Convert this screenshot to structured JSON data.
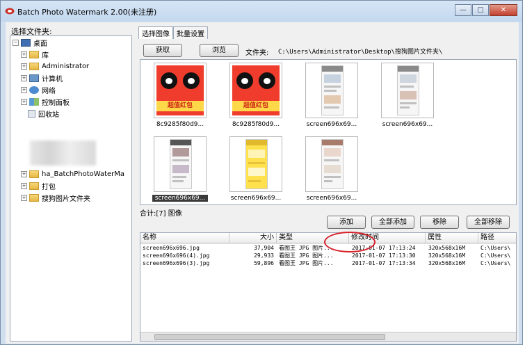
{
  "window": {
    "title": "Batch Photo Watermark 2.00(未注册)",
    "minimize_glyph": "—",
    "maximize_glyph": "□",
    "close_glyph": "✕"
  },
  "left_panel": {
    "label": "选择文件夹:",
    "tree": [
      {
        "label": "桌面",
        "icon": "desktop-icon",
        "expander": "−"
      },
      {
        "label": "库",
        "icon": "library-icon",
        "expander": "+"
      },
      {
        "label": "Administrator",
        "icon": "user-folder-icon",
        "expander": "+"
      },
      {
        "label": "计算机",
        "icon": "computer-icon",
        "expander": "+"
      },
      {
        "label": "网络",
        "icon": "network-icon",
        "expander": "+"
      },
      {
        "label": "控制面板",
        "icon": "control-panel-icon",
        "expander": "+"
      },
      {
        "label": "回收站",
        "icon": "recycle-bin-icon",
        "expander": ""
      },
      {
        "label": "ha_BatchPhotoWaterMa",
        "icon": "folder-icon",
        "expander": "+"
      },
      {
        "label": "打包",
        "icon": "folder-icon",
        "expander": "+"
      },
      {
        "label": "搜狗图片文件夹",
        "icon": "folder-icon",
        "expander": "+"
      }
    ]
  },
  "tabs": [
    "选择图像",
    "批量设置"
  ],
  "toolbar": {
    "refresh_label": "获取",
    "browse_label": "浏览",
    "folder_label": "文件夹:",
    "folder_path": "C:\\Users\\Administrator\\Desktop\\搜狗图片文件夹\\"
  },
  "thumbnails": [
    {
      "caption": "8c9285f80d9...",
      "kind": "red",
      "banner": "超值红包",
      "selected": false
    },
    {
      "caption": "8c9285f80d9...",
      "kind": "red",
      "banner": "超值红包",
      "selected": false
    },
    {
      "caption": "screen696x69...",
      "kind": "phone",
      "selected": false
    },
    {
      "caption": "screen696x69...",
      "kind": "phone",
      "selected": false
    },
    {
      "caption": "screen696x69...",
      "kind": "phone",
      "selected": true
    },
    {
      "caption": "screen696x69...",
      "kind": "phone-yellow",
      "selected": false
    },
    {
      "caption": "screen696x69...",
      "kind": "phone",
      "selected": false
    }
  ],
  "summary": "合计:[7] 图像",
  "actions": {
    "add_label": "添加",
    "add_all_label": "全部添加",
    "remove_label": "移除",
    "remove_all_label": "全部移除"
  },
  "file_list": {
    "columns": [
      "名称",
      "大小",
      "类型",
      "修改时间",
      "属性",
      "路径"
    ],
    "rows": [
      {
        "name": "screen696x696.jpg",
        "size": "37,904",
        "type": "看图王 JPG 图片...",
        "modified": "2017-01-07 17:13:24",
        "attr": "320x568x16M",
        "path": "C:\\Users\\"
      },
      {
        "name": "screen696x696(4).jpg",
        "size": "29,933",
        "type": "看图王 JPG 图片...",
        "modified": "2017-01-07 17:13:30",
        "attr": "320x568x16M",
        "path": "C:\\Users\\"
      },
      {
        "name": "screen696x696(3).jpg",
        "size": "59,896",
        "type": "看图王 JPG 图片...",
        "modified": "2017-01-07 17:13:34",
        "attr": "320x568x16M",
        "path": "C:\\Users\\"
      }
    ]
  },
  "colors": {
    "highlight_circle": "#d8202a",
    "title_bar": "#c3d7ee",
    "selected_caption": "#3a3a3a"
  }
}
